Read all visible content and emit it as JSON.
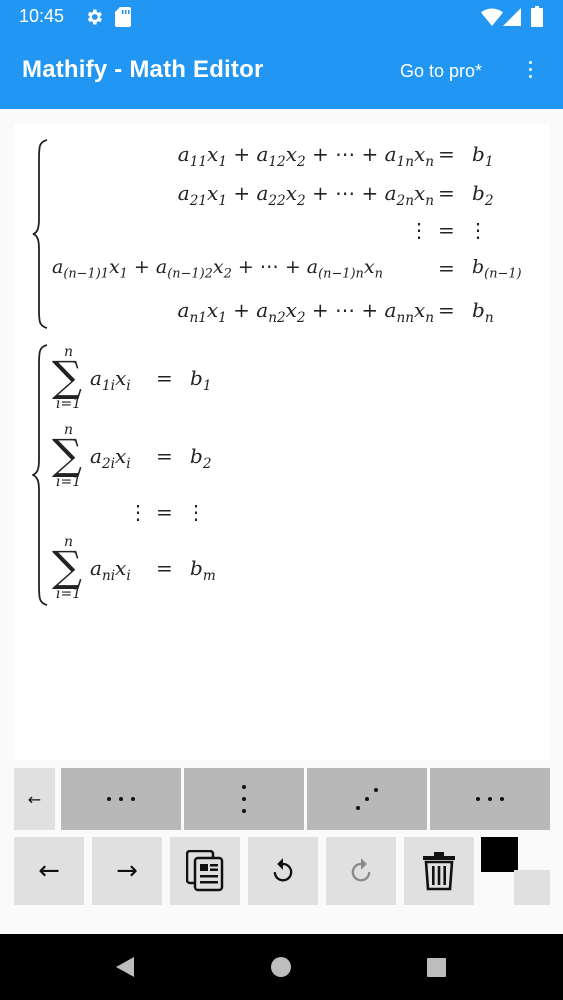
{
  "status": {
    "time": "10:45",
    "icons": [
      "settings-icon",
      "sd-card-icon",
      "wifi-icon",
      "cell-signal-icon",
      "battery-icon"
    ]
  },
  "app_bar": {
    "title": "Mathify - Math Editor",
    "go_pro": "Go to pro*",
    "overflow_icon": "more-vert-icon"
  },
  "editor": {
    "system1": {
      "rows": [
        {
          "lhs": "a₁₁x₁ + a₁₂x₂ + ⋯ + a₁ₙxₙ",
          "rel": "=",
          "rhs": "b₁"
        },
        {
          "lhs": "a₂₁x₁ + a₂₂x₂ + ⋯ + a₂ₙxₙ",
          "rel": "=",
          "rhs": "b₂"
        },
        {
          "lhs": "⋮",
          "rel": "=",
          "rhs": "⋮"
        },
        {
          "lhs": "a₍ₙ₋₁₎₁x₁ + a₍ₙ₋₁₎₂x₂ + ⋯ + a₍ₙ₋₁₎ₙxₙ",
          "rel": "=",
          "rhs": "b₍ₙ₋₁₎"
        },
        {
          "lhs": "aₙ₁x₁ + aₙ₂x₂ + ⋯ + aₙₙxₙ",
          "rel": "=",
          "rhs": "bₙ"
        }
      ]
    },
    "system2": {
      "rows": [
        {
          "sum_top": "n",
          "sum_bottom": "i=1",
          "lhs": "a₁ᵢxᵢ",
          "rel": "=",
          "rhs": "b₁"
        },
        {
          "sum_top": "n",
          "sum_bottom": "i=1",
          "lhs": "a₂ᵢxᵢ",
          "rel": "=",
          "rhs": "b₂"
        },
        {
          "lhs": "⋮",
          "rel": "=",
          "rhs": "⋮"
        },
        {
          "sum_top": "n",
          "sum_bottom": "i=1",
          "lhs": "aₙᵢxᵢ",
          "rel": "=",
          "rhs": "bₘ"
        }
      ]
    }
  },
  "keyboard": {
    "row1": [
      {
        "label": "←",
        "icon": "back-arrow-icon"
      },
      {
        "label": "⋯",
        "icon": "horizontal-dots-icon"
      },
      {
        "label": "⋮",
        "icon": "vertical-dots-icon"
      },
      {
        "label": "⋰",
        "icon": "diagonal-dots-icon"
      },
      {
        "label": "⋯",
        "icon": "horizontal-dots-icon"
      }
    ],
    "row2": [
      {
        "label": "←",
        "icon": "cursor-left-icon"
      },
      {
        "label": "→",
        "icon": "cursor-right-icon"
      },
      {
        "label": "",
        "icon": "copy-icon"
      },
      {
        "label": "",
        "icon": "undo-icon"
      },
      {
        "label": "",
        "icon": "redo-icon"
      },
      {
        "label": "",
        "icon": "delete-icon"
      }
    ],
    "color_swatch": "#000000"
  },
  "nav": {
    "back": "back-icon",
    "home": "home-icon",
    "recents": "recents-icon"
  }
}
